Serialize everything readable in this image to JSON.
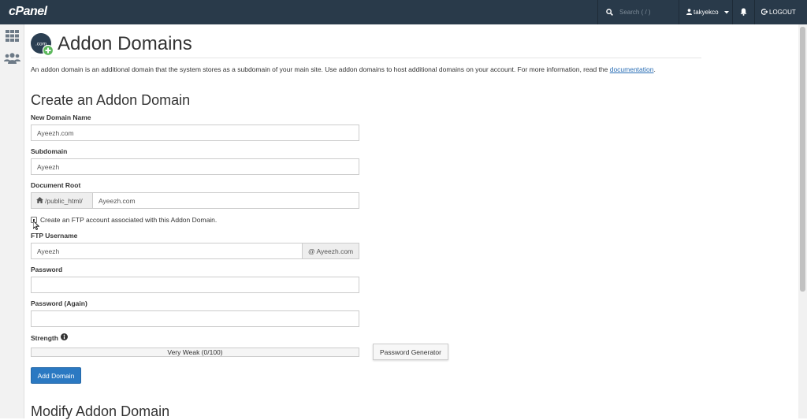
{
  "topbar": {
    "logo": "cPanel",
    "search_placeholder": "Search ( / )",
    "username": "takyekco",
    "logout_label": "LOGOUT"
  },
  "page": {
    "title": "Addon Domains",
    "intro_text": "An addon domain is an additional domain that the system stores as a subdomain of your main site. Use addon domains to host additional domains on your account. For more information, read the ",
    "intro_link": "documentation",
    "intro_end": "."
  },
  "form": {
    "section_title": "Create an Addon Domain",
    "new_domain_label": "New Domain Name",
    "new_domain_value": "Ayeezh.com",
    "subdomain_label": "Subdomain",
    "subdomain_value": "Ayeezh",
    "docroot_label": "Document Root",
    "docroot_prefix": "/public_html/",
    "docroot_value": "Ayeezh.com",
    "ftp_checkbox_label": "Create an FTP account associated with this Addon Domain.",
    "ftp_username_label": "FTP Username",
    "ftp_username_value": "Ayeezh",
    "ftp_username_suffix": "@ Ayeezh.com",
    "password_label": "Password",
    "password_again_label": "Password (Again)",
    "strength_label": "Strength",
    "strength_text": "Very Weak (0/100)",
    "strength_score": 0,
    "password_generator_label": "Password Generator",
    "submit_label": "Add Domain"
  },
  "modify": {
    "section_title": "Modify Addon Domain"
  }
}
